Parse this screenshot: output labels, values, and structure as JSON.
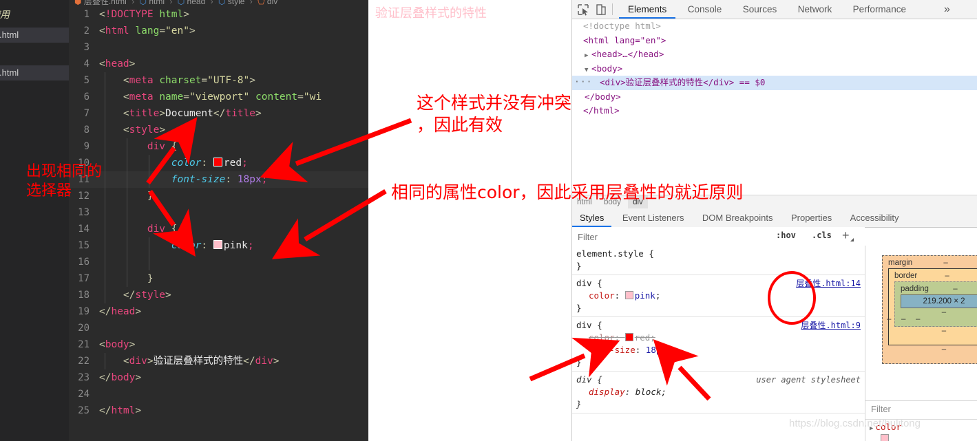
{
  "editor": {
    "explorer": {
      "folder_label": "使用",
      "files": [
        "性.html",
        "性.html"
      ]
    },
    "breadcrumb": {
      "file": "层叠性.html",
      "parts": [
        "html",
        "head",
        "style",
        "div"
      ]
    },
    "lines": [
      {
        "n": "1",
        "text": "<!DOCTYPE html>"
      },
      {
        "n": "2",
        "text": "<html lang=\"en\">"
      },
      {
        "n": "3",
        "text": ""
      },
      {
        "n": "4",
        "text": "<head>"
      },
      {
        "n": "5",
        "text": "    <meta charset=\"UTF-8\">"
      },
      {
        "n": "6",
        "text": "    <meta name=\"viewport\" content=\"wi"
      },
      {
        "n": "7",
        "text": "    <title>Document</title>"
      },
      {
        "n": "8",
        "text": "    <style>"
      },
      {
        "n": "9",
        "text": "        div {"
      },
      {
        "n": "10",
        "text": "            color: red;"
      },
      {
        "n": "11",
        "text": "            font-size: 18px;"
      },
      {
        "n": "12",
        "text": "        }"
      },
      {
        "n": "13",
        "text": ""
      },
      {
        "n": "14",
        "text": "        div {"
      },
      {
        "n": "15",
        "text": "            color: pink;"
      },
      {
        "n": "16",
        "text": ""
      },
      {
        "n": "17",
        "text": "        }"
      },
      {
        "n": "18",
        "text": "    </style>"
      },
      {
        "n": "19",
        "text": "</head>"
      },
      {
        "n": "20",
        "text": ""
      },
      {
        "n": "21",
        "text": "<body>"
      },
      {
        "n": "22",
        "text": "    <div>验证层叠样式的特性</div>"
      },
      {
        "n": "23",
        "text": "</body>"
      },
      {
        "n": "24",
        "text": ""
      },
      {
        "n": "25",
        "text": "</html>"
      }
    ],
    "tokens": {
      "doctype": "!DOCTYPE",
      "html_tag": "html",
      "lang_attr": "lang",
      "lang_value": "\"en\"",
      "head_tag": "head",
      "meta_tag": "meta",
      "charset_attr": "charset",
      "charset_value": "\"UTF-8\"",
      "name_attr": "name",
      "name_value": "\"viewport\"",
      "content_attr": "content",
      "content_value": "\"wi",
      "title_tag": "title",
      "title_text": "Document",
      "style_tag": "style",
      "body_tag": "body",
      "div_tag": "div",
      "selector": "div",
      "prop_color": "color",
      "val_red": "red",
      "val_pink": "pink",
      "prop_font_size": "font-size",
      "val_18px": "18px",
      "div_text": "验证层叠样式的特性"
    },
    "colors": {
      "red_swatch": "#ff0000",
      "pink_swatch": "#ffc0cb"
    }
  },
  "browser": {
    "rendered_text": "验证层叠样式的特性",
    "rendered_color": "#ffc0cb"
  },
  "devtools": {
    "tabs": [
      "Elements",
      "Console",
      "Sources",
      "Network",
      "Performance"
    ],
    "active_tab": "Elements",
    "more_glyph": "»",
    "dom": [
      {
        "indent": 0,
        "tri": "",
        "text": "<!doctype html>",
        "kind": "doctype",
        "selected": false
      },
      {
        "indent": 0,
        "tri": "",
        "text": "<html lang=\"en\">",
        "kind": "open",
        "selected": false
      },
      {
        "indent": 1,
        "tri": "▶",
        "text": "<head>…</head>",
        "kind": "collapsed",
        "selected": false
      },
      {
        "indent": 1,
        "tri": "▼",
        "text": "<body>",
        "kind": "open",
        "selected": false
      },
      {
        "indent": 2,
        "tri": "",
        "text": "<div>验证层叠样式的特性</div> == $0",
        "kind": "div",
        "selected": true
      },
      {
        "indent": 1,
        "tri": "",
        "text": "</body>",
        "kind": "close",
        "selected": false
      },
      {
        "indent": 0,
        "tri": "",
        "text": "</html>",
        "kind": "close",
        "selected": false
      }
    ],
    "node_crumbs": [
      "html",
      "body",
      "div"
    ],
    "node_crumb_current": "div",
    "styles_tabs": [
      "Styles",
      "Event Listeners",
      "DOM Breakpoints",
      "Properties",
      "Accessibility"
    ],
    "styles_active": "Styles",
    "filter_placeholder": "Filter",
    "hov_label": ":hov",
    "cls_label": ".cls",
    "plus_label": "+",
    "rules": [
      {
        "selector": "element.style {",
        "source": "",
        "declarations": [],
        "closing": "}"
      },
      {
        "selector": "div {",
        "source": "层叠性.html:14",
        "declarations": [
          {
            "prop": "color",
            "value": "pink",
            "swatch": "#ffc0cb",
            "struck": false
          }
        ],
        "closing": "}"
      },
      {
        "selector": "div {",
        "source": "层叠性.html:9",
        "declarations": [
          {
            "prop": "color",
            "value": "red",
            "swatch": "#ff0000",
            "struck": true
          },
          {
            "prop": "font-size",
            "value": "18px",
            "swatch": "",
            "struck": false
          }
        ],
        "closing": "}"
      },
      {
        "selector": "div {",
        "source": "user agent stylesheet",
        "ua": true,
        "declarations": [
          {
            "prop": "display",
            "value": "block",
            "swatch": "",
            "struck": false
          }
        ],
        "closing": "}"
      }
    ],
    "box_model": {
      "margin_label": "margin",
      "border_label": "border",
      "padding_label": "padding",
      "content_size": "219.200 × 2",
      "dash": "–"
    },
    "computed_filter_placeholder": "Filter",
    "computed_first_prop": "color"
  },
  "annotations": [
    {
      "id": "anno-a",
      "text": "出现相同的\n选择器"
    },
    {
      "id": "anno-b",
      "text": "这个样式并没有冲突\n，因此有效"
    },
    {
      "id": "anno-c",
      "text": "相同的属性color，因此采用层叠性的就近原则"
    }
  ],
  "watermark": "https://blog.csdn.net/hulitong"
}
